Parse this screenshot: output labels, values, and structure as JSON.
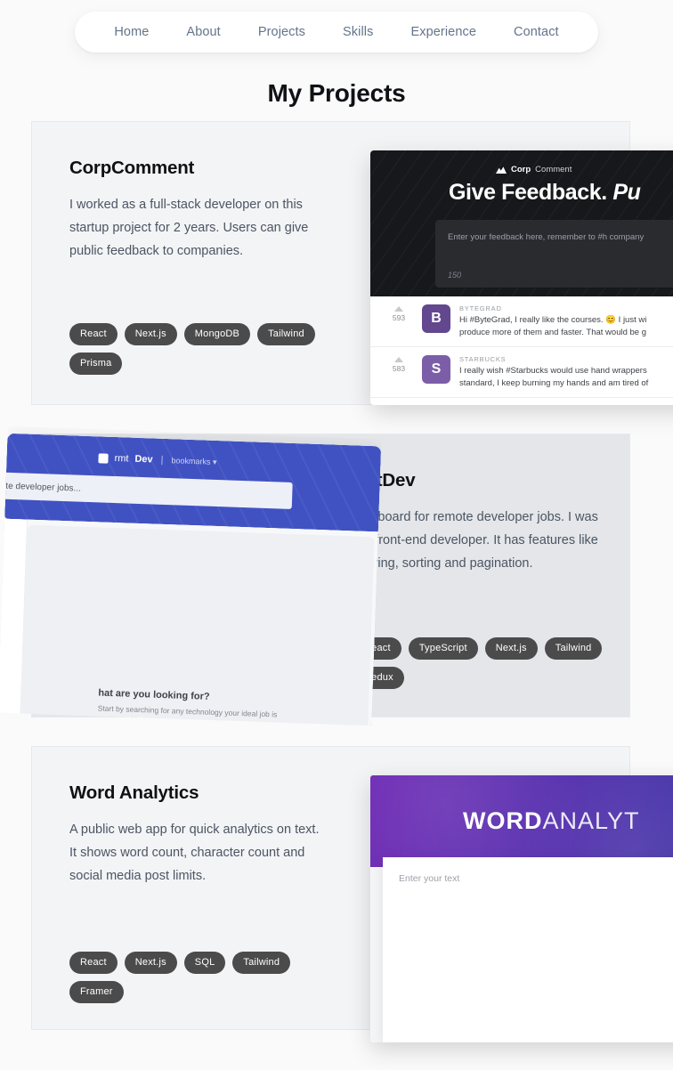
{
  "nav": {
    "items": [
      {
        "label": "Home"
      },
      {
        "label": "About"
      },
      {
        "label": "Projects"
      },
      {
        "label": "Skills"
      },
      {
        "label": "Experience"
      },
      {
        "label": "Contact"
      }
    ]
  },
  "heading": {
    "title": "My Projects"
  },
  "projects": [
    {
      "title": "CorpComment",
      "description": "I worked as a full-stack developer on this startup project for 2 years. Users can give public feedback to companies.",
      "tags": [
        "React",
        "Next.js",
        "MongoDB",
        "Tailwind",
        "Prisma"
      ],
      "screenshot": {
        "app": "CorpComment",
        "logo_bold": "Corp",
        "logo_light": "Comment",
        "hero_title_bold": "Give Feedback.",
        "hero_title_italic": "Pu",
        "textarea_placeholder": "Enter your feedback here, remember to #h company",
        "char_count": "150",
        "feedback": [
          {
            "votes": "593",
            "avatar_letter": "B",
            "company": "BYTEGRAD",
            "message_line1": "Hi #ByteGrad, I really like the courses. 😊 I just wi",
            "message_line2": "produce more of them and faster. That would be g"
          },
          {
            "votes": "583",
            "avatar_letter": "S",
            "company": "STARBUCKS",
            "message_line1": "I really wish #Starbucks would use hand wrappers",
            "message_line2": "standard, I keep burning my hands and am tired of"
          }
        ]
      }
    },
    {
      "title": "rmtDev",
      "description": "Job board for remote developer jobs. I was the front-end developer. It has features like filtering, sorting and pagination.",
      "tags": [
        "React",
        "TypeScript",
        "Next.js",
        "Tailwind",
        "Redux"
      ],
      "screenshot": {
        "app": "rmtDev",
        "logo_light": "rmt",
        "logo_bold": "Dev",
        "nav_link": "bookmarks ▾",
        "search_placeholder": "te developer jobs...",
        "empty_title": "hat are you looking for?",
        "empty_subtitle": "Start by searching for any technology your ideal job is working with"
      }
    },
    {
      "title": "Word Analytics",
      "description": "A public web app for quick analytics on text. It shows word count, character count and social media post limits.",
      "tags": [
        "React",
        "Next.js",
        "SQL",
        "Tailwind",
        "Framer"
      ],
      "screenshot": {
        "app": "Word Analytics",
        "title_bold": "WORD",
        "title_light": "ANALYT",
        "input_placeholder": "Enter your text"
      }
    }
  ],
  "colors": {
    "page_background": "#fafafa",
    "card_background": "#f3f4f6",
    "card_background_alt": "#e4e6e9",
    "tag_background": "#4b4b4b",
    "nav_text": "#64748b",
    "title_text": "#0f1115",
    "body_text": "#4b5563",
    "rmtdev_blue": "#4052c2",
    "wordanalytics_purple": "#5a32b0",
    "corpcomment_dark": "#17181b"
  }
}
